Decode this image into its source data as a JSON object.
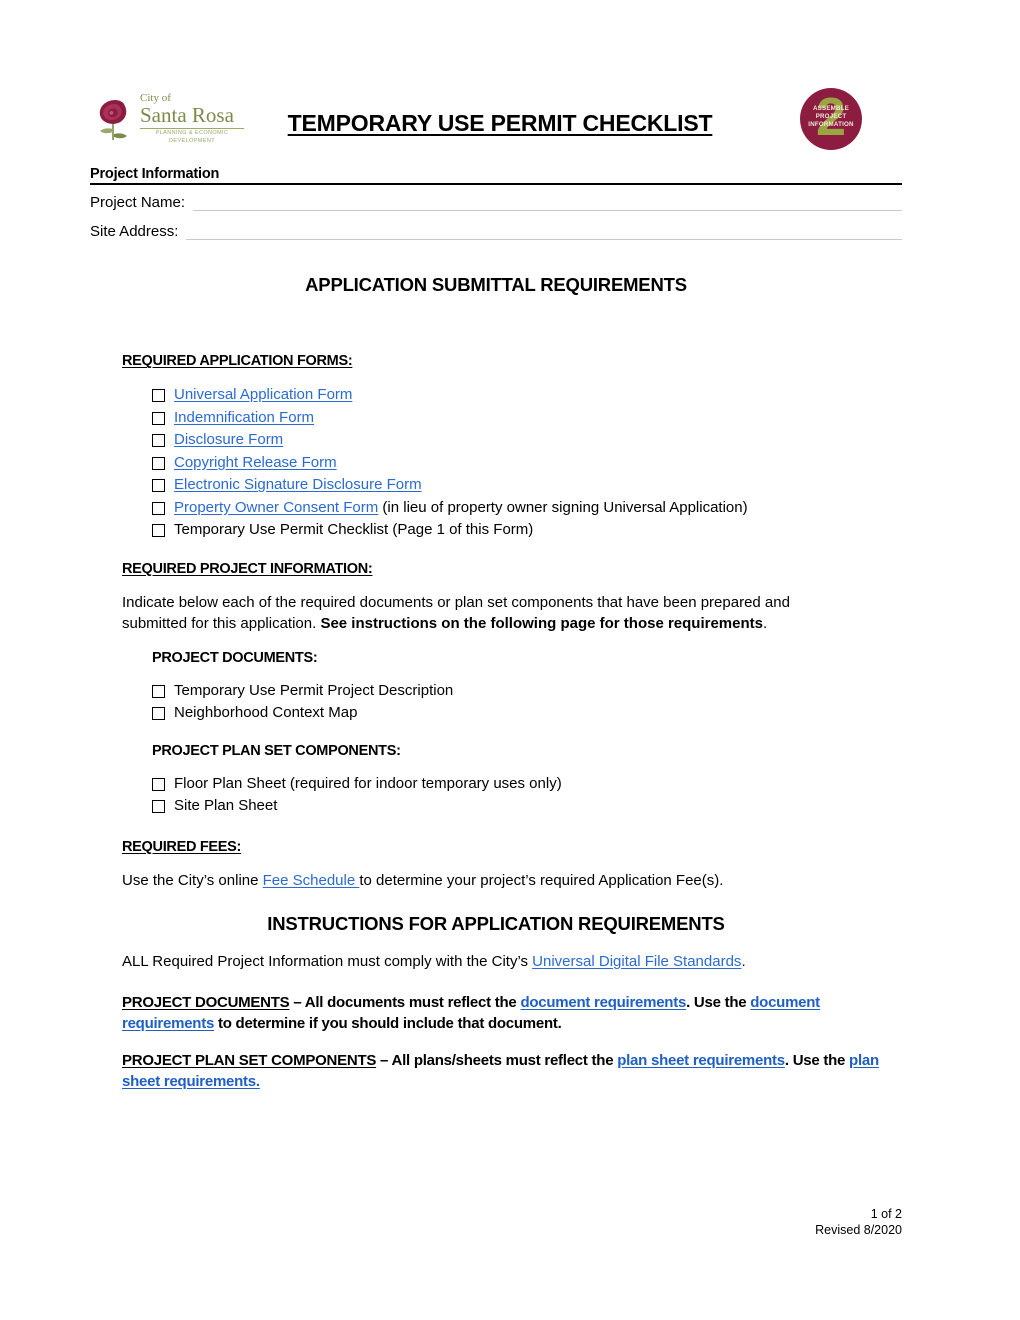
{
  "header": {
    "logo": {
      "city_of": "City of",
      "city_name": "Santa Rosa",
      "department_line1": "PLANNING & ECONOMIC",
      "department_line2": "DEVELOPMENT"
    },
    "title": "TEMPORARY USE PERMIT CHECKLIST",
    "badge": {
      "number": "2",
      "line1": "ASSEMBLE",
      "line2": "PROJECT",
      "line3": "INFORMATION"
    }
  },
  "project_information": {
    "section_label": "Project Information",
    "fields": [
      {
        "label": "Project Name:",
        "value": ""
      },
      {
        "label": "Site Address:",
        "value": ""
      }
    ]
  },
  "submittal": {
    "heading": "APPLICATION SUBMITTAL REQUIREMENTS",
    "required_forms": {
      "heading": "REQUIRED APPLICATION FORMS:",
      "items": [
        {
          "link": "Universal Application Form",
          "suffix": ""
        },
        {
          "link": "Indemnification Form",
          "suffix": ""
        },
        {
          "link": "Disclosure Form",
          "suffix": ""
        },
        {
          "link": "Copyright Release Form",
          "suffix": ""
        },
        {
          "link": "Electronic Signature Disclosure Form",
          "suffix": ""
        },
        {
          "link": "Property Owner Consent Form",
          "suffix": " (in lieu of property owner signing Universal Application)"
        },
        {
          "link": "",
          "suffix": "Temporary Use Permit Checklist (Page 1 of this Form)"
        }
      ]
    },
    "required_project_information": {
      "heading": "REQUIRED PROJECT INFORMATION:",
      "intro_plain": "Indicate below each of the required documents or plan set components that have been prepared and submitted for this application. ",
      "intro_bold": "See instructions on the following page for those requirements",
      "intro_end": ".",
      "project_documents": {
        "heading": "PROJECT DOCUMENTS:",
        "items": [
          "Temporary Use Permit Project Description",
          "Neighborhood Context Map"
        ]
      },
      "plan_set_components": {
        "heading": "PROJECT PLAN SET COMPONENTS:",
        "items": [
          "Floor Plan Sheet (required for indoor temporary uses only)",
          "Site Plan Sheet"
        ]
      }
    },
    "required_fees": {
      "heading": "REQUIRED FEES:",
      "text_before": "Use the City’s online ",
      "link": "Fee Schedule ",
      "text_after": "to determine your project’s required Application Fee(s)."
    }
  },
  "instructions": {
    "heading": "INSTRUCTIONS FOR APPLICATION REQUIREMENTS",
    "intro_before": "ALL Required Project Information must comply with the City’s ",
    "intro_link": "Universal Digital File Standards",
    "intro_after": ".",
    "documents_para": {
      "label": "PROJECT DOCUMENTS",
      "part1": " – All documents must reflect the ",
      "link1": "document requirements",
      "part2": ". Use the ",
      "link2": "document requirements",
      "part3": " to determine if you should include that document."
    },
    "plan_set_para": {
      "label": "PROJECT PLAN SET COMPONENTS",
      "part1": " – All plans/sheets must reflect the ",
      "link1": "plan sheet requirements",
      "part2": ". Use the ",
      "link2": "plan sheet requirements.",
      "part3": ""
    }
  },
  "footer": {
    "page": "1 of 2",
    "revised": "Revised 8/2020"
  },
  "colors": {
    "link": "#2a6ad4",
    "logo_green": "#7b8c4a",
    "badge_maroon": "#8c1d40",
    "badge_number": "#9aa441"
  }
}
